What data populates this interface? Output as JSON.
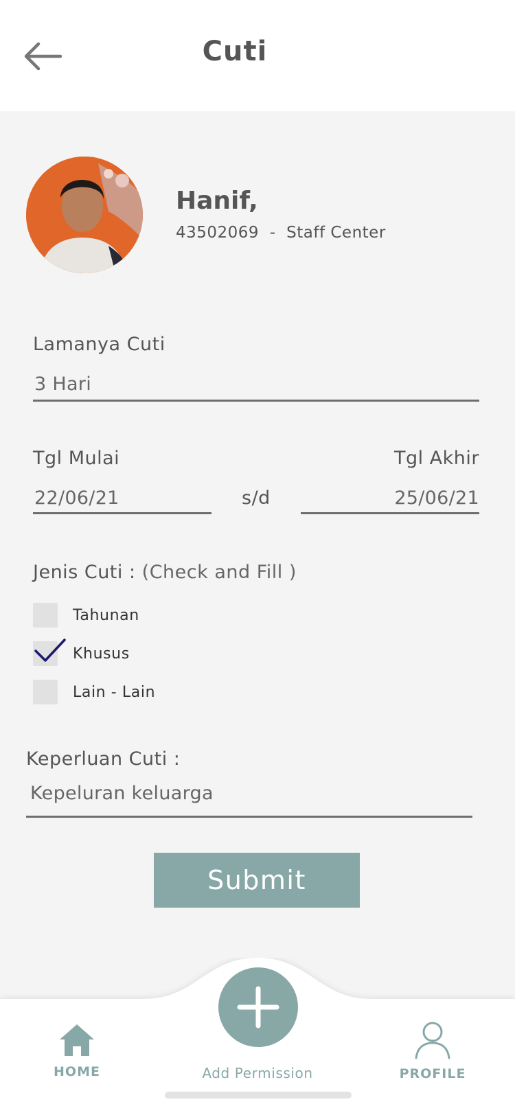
{
  "header": {
    "title": "Cuti",
    "back_icon": "arrow-left-icon"
  },
  "profile": {
    "name": "Hanif,",
    "employee_id": "43502069",
    "separator": "-",
    "role": "Staff Center"
  },
  "form": {
    "duration": {
      "label": "Lamanya Cuti",
      "value": "3 Hari"
    },
    "start_date": {
      "label": "Tgl Mulai",
      "value": "22/06/21"
    },
    "range_separator": "s/d",
    "end_date": {
      "label": "Tgl Akhir",
      "value": "25/06/21"
    },
    "leave_type": {
      "label": "Jenis Cuti :",
      "hint": " (Check and Fill )",
      "options": [
        {
          "label": "Tahunan",
          "checked": false
        },
        {
          "label": "Khusus",
          "checked": true
        },
        {
          "label": "Lain - Lain",
          "checked": false
        }
      ]
    },
    "purpose": {
      "label": "Keperluan Cuti :",
      "value": "Kepeluran keluarga"
    },
    "submit_label": "Submit"
  },
  "bottom_nav": {
    "home_label": "HOME",
    "add_label": "Add Permission",
    "profile_label": "PROFILE"
  },
  "colors": {
    "accent": "#88a8a8",
    "check": "#1a1a6e",
    "background": "#f4f4f4"
  }
}
